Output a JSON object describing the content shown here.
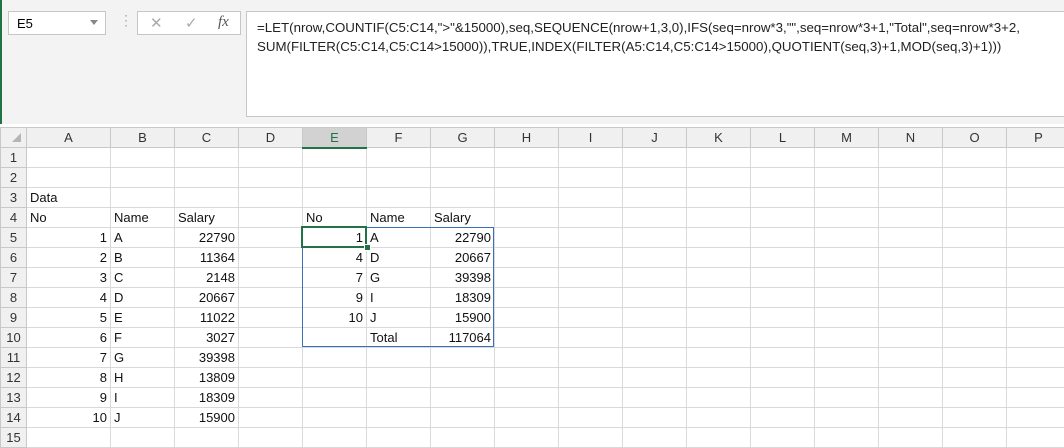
{
  "formula_bar": {
    "name_box": "E5",
    "cancel_icon": "✕",
    "enter_icon": "✓",
    "fx_label": "fx",
    "formula_line1": "=LET(nrow,COUNTIF(C5:C14,\">\"&15000),seq,SEQUENCE(nrow+1,3,0),IFS(seq=nrow*3,\"\",seq=nrow*3+1,\"Total\",seq=nrow*3+2,",
    "formula_line2": "SUM(FILTER(C5:C14,C5:C14>15000)),TRUE,INDEX(FILTER(A5:C14,C5:C14>15000),QUOTIENT(seq,3)+1,MOD(seq,3)+1)))"
  },
  "columns": [
    "A",
    "B",
    "C",
    "D",
    "E",
    "F",
    "G",
    "H",
    "I",
    "J",
    "K",
    "L",
    "M",
    "N",
    "O",
    "P"
  ],
  "selected_column": "E",
  "rows": [
    {
      "n": "1",
      "cells": {}
    },
    {
      "n": "2",
      "cells": {}
    },
    {
      "n": "3",
      "cells": {
        "A": "Data"
      }
    },
    {
      "n": "4",
      "cells": {
        "A": "No",
        "B": "Name",
        "C": "Salary",
        "E": "No",
        "F": "Name",
        "G": "Salary"
      }
    },
    {
      "n": "5",
      "cells": {
        "A": "1",
        "B": "A",
        "C": "22790",
        "E": "1",
        "F": "A",
        "G": "22790"
      }
    },
    {
      "n": "6",
      "cells": {
        "A": "2",
        "B": "B",
        "C": "11364",
        "E": "4",
        "F": "D",
        "G": "20667"
      }
    },
    {
      "n": "7",
      "cells": {
        "A": "3",
        "B": "C",
        "C": "2148",
        "E": "7",
        "F": "G",
        "G": "39398"
      }
    },
    {
      "n": "8",
      "cells": {
        "A": "4",
        "B": "D",
        "C": "20667",
        "E": "9",
        "F": "I",
        "G": "18309"
      }
    },
    {
      "n": "9",
      "cells": {
        "A": "5",
        "B": "E",
        "C": "11022",
        "E": "10",
        "F": "J",
        "G": "15900"
      }
    },
    {
      "n": "10",
      "cells": {
        "A": "6",
        "B": "F",
        "C": "3027",
        "F": "Total",
        "G": "117064"
      }
    },
    {
      "n": "11",
      "cells": {
        "A": "7",
        "B": "G",
        "C": "39398"
      }
    },
    {
      "n": "12",
      "cells": {
        "A": "8",
        "B": "H",
        "C": "13809"
      }
    },
    {
      "n": "13",
      "cells": {
        "A": "9",
        "B": "I",
        "C": "18309"
      }
    },
    {
      "n": "14",
      "cells": {
        "A": "10",
        "B": "J",
        "C": "15900"
      }
    },
    {
      "n": "15",
      "cells": {}
    }
  ]
}
